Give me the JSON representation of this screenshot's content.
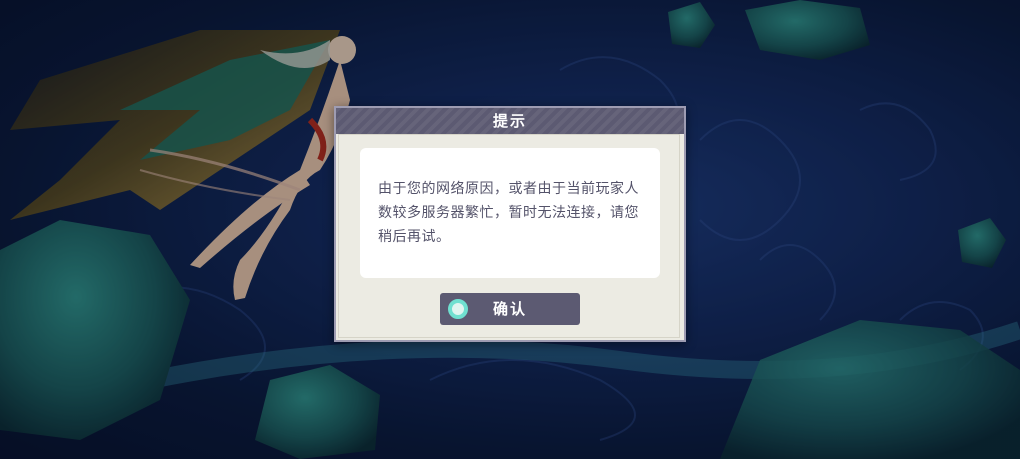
{
  "dialog": {
    "title": "提示",
    "message": "由于您的网络原因，或者由于当前玩家人数较多服务器繁忙，暂时无法连接，请您稍后再试。",
    "confirm_label": "确认",
    "confirm_icon": "circle-icon"
  },
  "colors": {
    "header": "#5c5a72",
    "panel": "#ecebe3",
    "text": "#54536a",
    "accent": "#6fe0d0"
  }
}
